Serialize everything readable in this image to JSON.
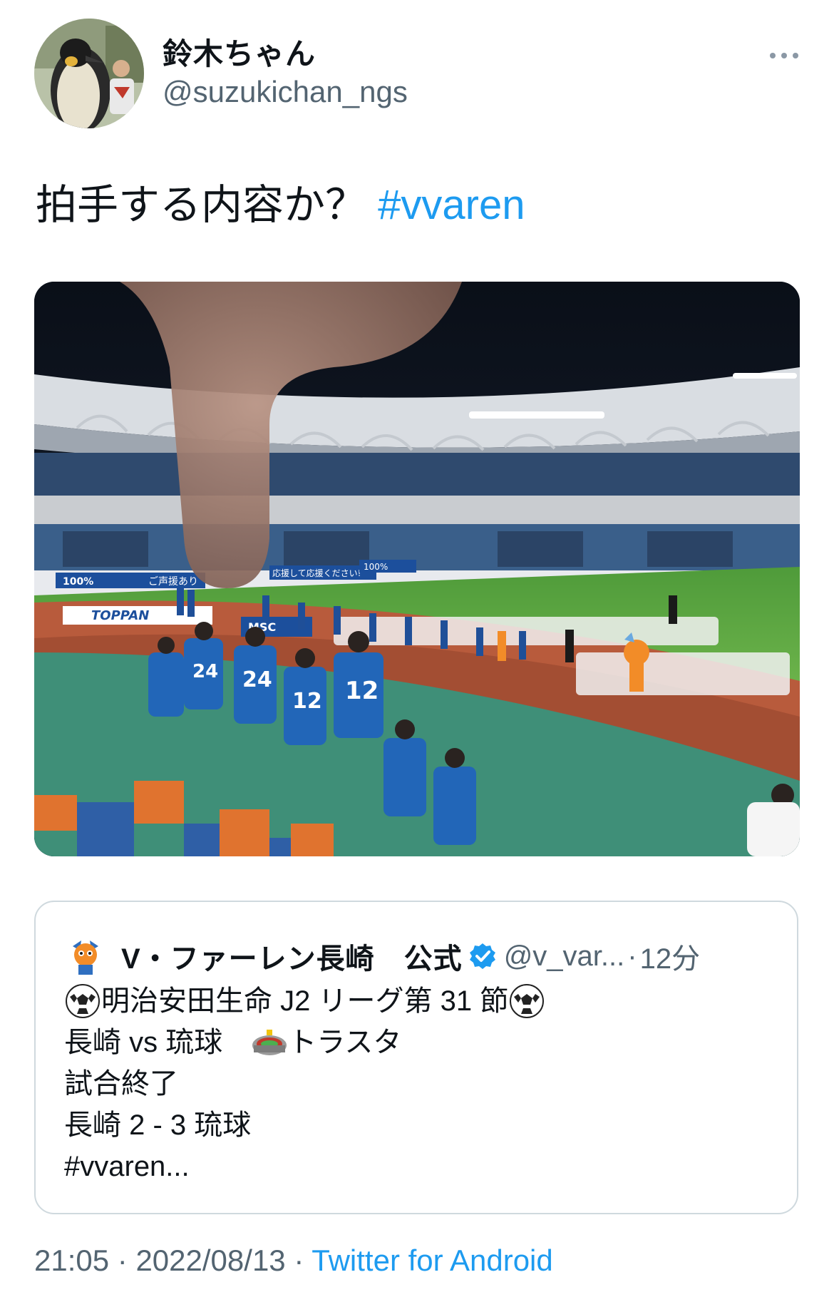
{
  "author": {
    "display_name": "鈴木ちゃん",
    "handle": "@suzukichan_ngs",
    "avatar_icon": "penguin-photo-avatar"
  },
  "more_icon": "more-horizontal-icon",
  "tweet": {
    "text": "拍手する内容か？",
    "hashtag": "#vvaren"
  },
  "media": {
    "banners": {
      "b1": "100%",
      "b2": "ご声援あり",
      "b3": "応援して応援ください!",
      "b4": "100%",
      "b5": "TOPPAN",
      "b6": "MSC"
    },
    "jersey_numbers": [
      "24",
      "24",
      "12",
      "12"
    ]
  },
  "quoted_tweet": {
    "name": "V・ファーレン長崎　公式",
    "handle": "@v_var...",
    "separator": "·",
    "time": "12分",
    "lines": {
      "line1": "明治安田生命 J2 リーグ第 31 節",
      "line2_a": "長崎 vs 琉球　",
      "line2_b": "トラスタ",
      "line3": "試合終了",
      "line4": "長崎 2 - 3 琉球",
      "line5": "#vvaren..."
    },
    "colors": {
      "verified": "#1d9bf0"
    }
  },
  "meta": {
    "time": "21:05",
    "sep1": "·",
    "date": "2022/08/13",
    "sep2": "·",
    "source": "Twitter for Android"
  },
  "colors": {
    "accent": "#1d9bf0",
    "secondary_text": "#536471",
    "border": "#cfd9de"
  }
}
